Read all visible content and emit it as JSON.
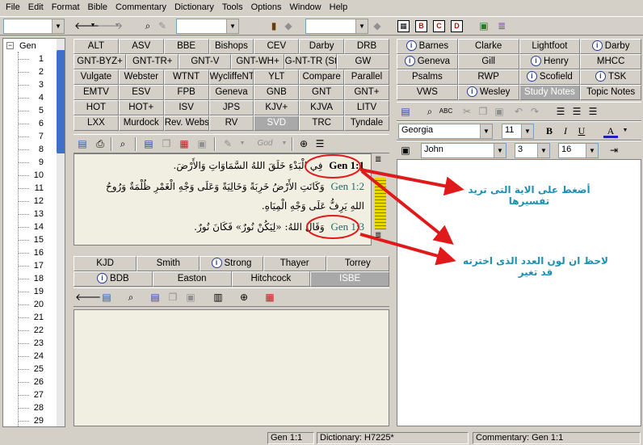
{
  "menu": [
    "File",
    "Edit",
    "Format",
    "Bible",
    "Commentary",
    "Dictionary",
    "Tools",
    "Options",
    "Window",
    "Help"
  ],
  "tree": {
    "root": "Gen",
    "chapters": [
      "1",
      "2",
      "3",
      "4",
      "5",
      "6",
      "7",
      "8",
      "9",
      "10",
      "11",
      "12",
      "13",
      "14",
      "15",
      "16",
      "17",
      "18",
      "19",
      "20",
      "21",
      "22",
      "23",
      "24",
      "25",
      "26",
      "27",
      "28",
      "29"
    ]
  },
  "bible_tabs": [
    [
      "ALT",
      "ASV",
      "BBE",
      "Bishops",
      "CEV",
      "Darby",
      "DRB"
    ],
    [
      "GNT-BYZ+",
      "GNT-TR+",
      "GNT-V",
      "GNT-WH+",
      "G-NT-TR (Steph)+",
      "GW"
    ],
    [
      "Vulgate",
      "Webster",
      "WTNT",
      "WycliffeNT",
      "YLT",
      "Compare",
      "Parallel"
    ],
    [
      "EMTV",
      "ESV",
      "FPB",
      "Geneva",
      "GNB",
      "GNT",
      "GNT+"
    ],
    [
      "HOT",
      "HOT+",
      "ISV",
      "JPS",
      "KJV+",
      "KJVA",
      "LITV"
    ],
    [
      "LXX",
      "Murdock",
      "Rev. Webster+",
      "RV",
      "SVD",
      "TRC",
      "Tyndale"
    ]
  ],
  "bible_active_tab": "SVD",
  "bible_toolbar_god": "God",
  "verses": [
    {
      "ref": "Gen 1:1",
      "text": "فِي الْبَدْءِ خَلَقَ اللهُ السَّمَاوَاتِ وَالأَرْضَ."
    },
    {
      "ref": "Gen 1:2",
      "text": "وَكَانَتِ الأَرْضُ خَرِبَةً وَخَالِيَةً وَعَلَى وَجْهِ الْغَمْرِ ظُلْمَةٌ وَرُوحُ"
    },
    {
      "ref": "",
      "text": "اللهِ يَرِفُّ عَلَى وَجْهِ الْمِيَاهِ."
    },
    {
      "ref": "Gen 1:3",
      "text": "وَقَالَ اللهُ: «لِيَكُنْ نُورٌ» فَكَانَ نُورٌ."
    }
  ],
  "dict_tabs": [
    [
      "KJD",
      "Smith",
      "Strong",
      "Thayer",
      "Torrey"
    ],
    [
      "BDB",
      "Easton",
      "Hitchcock",
      "ISBE"
    ]
  ],
  "dict_active_tab": "ISBE",
  "comm_tabs": [
    [
      "Barnes",
      "Clarke",
      "Lightfoot",
      "Darby"
    ],
    [
      "Geneva",
      "Gill",
      "Henry",
      "MHCC"
    ],
    [
      "Psalms",
      "RWP",
      "Scofield",
      "TSK"
    ],
    [
      "VWS",
      "Wesley",
      "Study Notes",
      "Topic Notes"
    ]
  ],
  "comm_active_tab": "Study Notes",
  "comm_font": "Georgia",
  "comm_font_size": "11",
  "comm_user": "John",
  "comm_chapter": "3",
  "comm_zoom": "16",
  "status": {
    "verse": "Gen 1:1",
    "dictionary": "Dictionary: H7225*",
    "commentary": "Commentary: Gen 1:1"
  },
  "annotations": {
    "callout1_line1": "أضغط على الاية التى تريد",
    "callout1_line2": "تفسيرها",
    "callout2_line1": "لاحظ ان لون العدد الذى اخترته",
    "callout2_line2": "قد تغير"
  },
  "colors": {
    "panel_bg": "#d4d0c8",
    "text_bg": "#f1eee2",
    "verse_ref": "#1f6b6b",
    "annotation_red": "#e01a1a",
    "callout_text": "#1f8fb2"
  }
}
